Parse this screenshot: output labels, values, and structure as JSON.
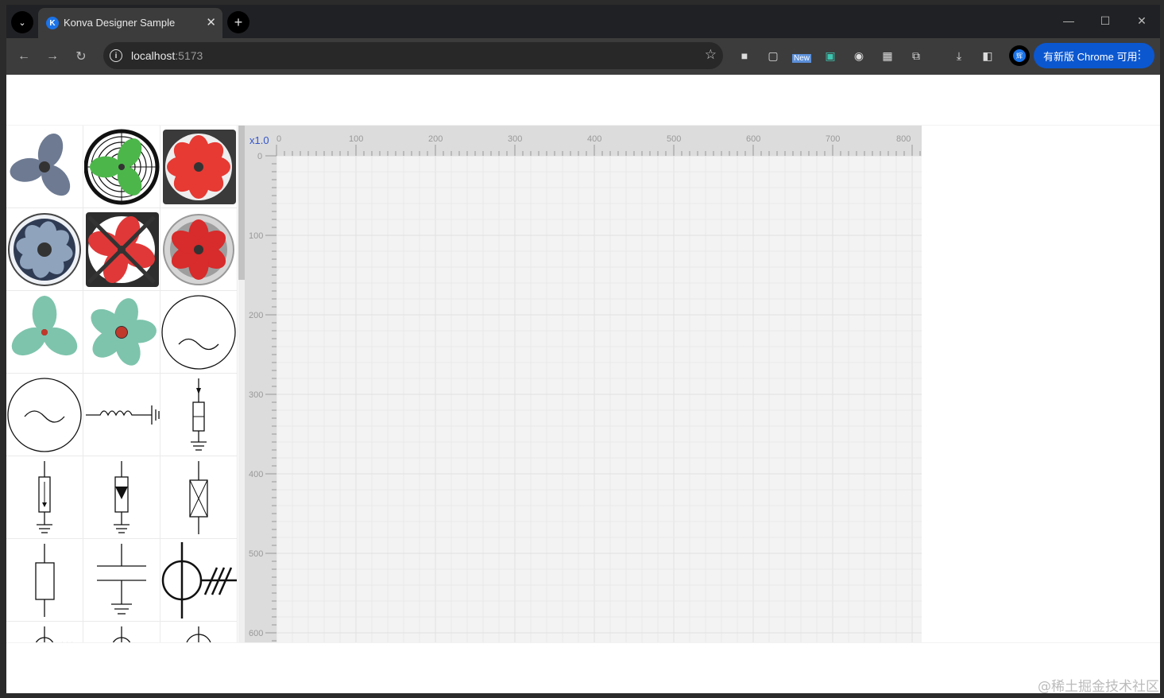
{
  "browser": {
    "tab_title": "Konva Designer Sample",
    "tab_favicon_letter": "K",
    "tab_close": "✕",
    "new_tab": "+",
    "url_host": "localhost",
    "url_port": ":5173",
    "ext_new_badge": "New",
    "profile_letter": "辉",
    "update_button": "有新版 Chrome 可用",
    "window": {
      "minimize": "—",
      "maximize": "☐",
      "close": "✕"
    }
  },
  "editor": {
    "zoom_label": "x1.0",
    "ruler_x_ticks": [
      "0",
      "100",
      "200",
      "300",
      "400",
      "500",
      "600",
      "700",
      "800"
    ],
    "ruler_y_ticks": [
      "0",
      "100",
      "200",
      "300",
      "400",
      "500",
      "600"
    ],
    "palette": [
      {
        "name": "fan-blades-blue"
      },
      {
        "name": "fan-green-grille"
      },
      {
        "name": "fan-red-square"
      },
      {
        "name": "fan-round-blue"
      },
      {
        "name": "fan-red-black-square"
      },
      {
        "name": "fan-red-metal"
      },
      {
        "name": "fan-three-blade-teal"
      },
      {
        "name": "fan-five-blade-teal"
      },
      {
        "name": "ac-source-circle"
      },
      {
        "name": "ac-source-circle-large"
      },
      {
        "name": "inductor-ground"
      },
      {
        "name": "arrester-ground"
      },
      {
        "name": "resistor-arrow-ground"
      },
      {
        "name": "diode-ground"
      },
      {
        "name": "fuse-cross"
      },
      {
        "name": "resistor"
      },
      {
        "name": "capacitor-ground"
      },
      {
        "name": "transformer-hash"
      },
      {
        "name": "symbol-partial-1"
      },
      {
        "name": "symbol-partial-2"
      },
      {
        "name": "symbol-partial-3"
      }
    ],
    "colors": {
      "grid_bg": "#f3f3f3",
      "ruler_bg": "#dcdcdc",
      "zoom_text": "#3355cc"
    }
  },
  "watermark": "@稀土掘金技术社区"
}
